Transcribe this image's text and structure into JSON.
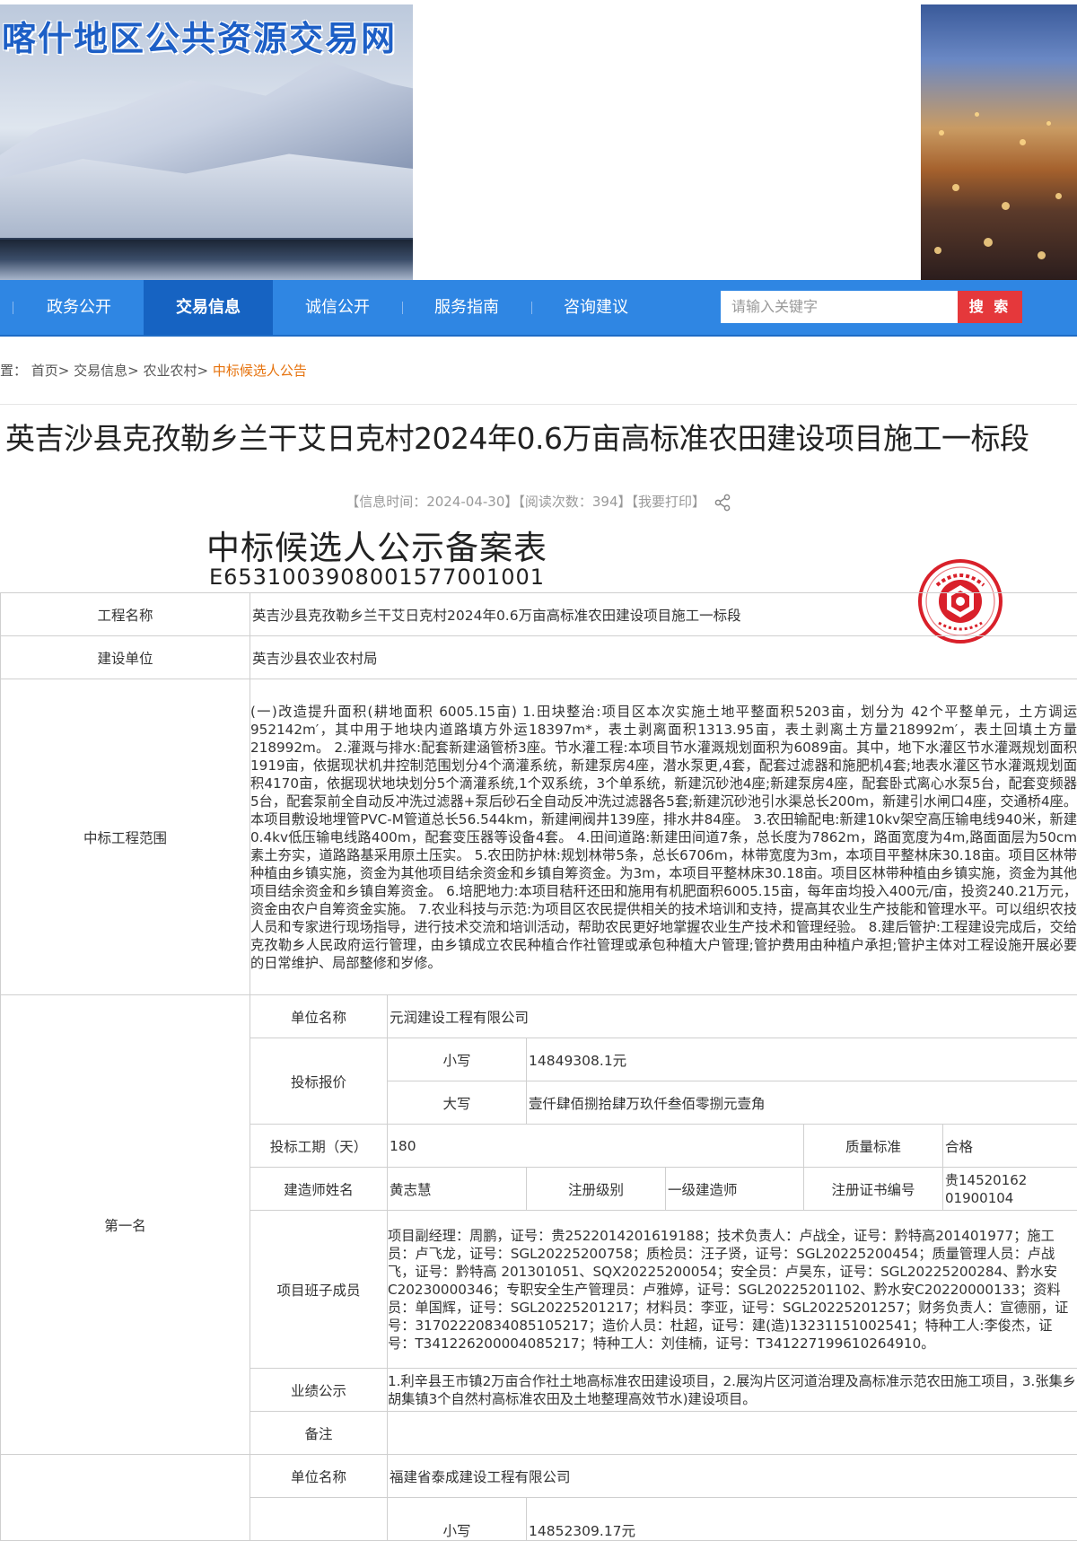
{
  "header": {
    "site_title": "喀什地区公共资源交易网"
  },
  "nav": {
    "items": [
      "政务公开",
      "交易信息",
      "诚信公开",
      "服务指南",
      "咨询建议"
    ],
    "active_index": 1,
    "search_placeholder": "请输入关键字",
    "search_button": "搜 索"
  },
  "breadcrumb": {
    "prefix": "置：",
    "items": [
      "首页>",
      "交易信息>",
      "农业农村>"
    ],
    "current": "中标候选人公告"
  },
  "article": {
    "title": "英吉沙县克孜勒乡兰干艾日克村2024年0.6万亩高标准农田建设项目施工一标段",
    "meta_time": "【信息时间：2024-04-30】",
    "meta_reads": "【阅读次数：394】",
    "meta_print": "【我要打印】",
    "doc_title": "中标候选人公示备案表",
    "doc_code": "E6531003908001577001001"
  },
  "table": {
    "project_name_label": "工程名称",
    "project_name": "英吉沙县克孜勒乡兰干艾日克村2024年0.6万亩高标准农田建设项目施工一标段",
    "builder_label": "建设单位",
    "builder": "英吉沙县农业农村局",
    "scope_label": "中标工程范围",
    "scope": "(一)改造提升面积(耕地面积 6005.15亩) 1.田块整治:项目区本次实施土地平整面积5203亩，划分为 42个平整单元，土方调运952142m′，其中用于地块内道路填方外运18397m*，表土剥离面积1313.95亩，表土剥离土方量218992m′，表土回填土方量218992m。 2.灌溉与排水:配套新建涵管桥3座。节水灌工程:本项目节水灌溉规划面积为6089亩。其中，地下水灌区节水灌溉规划面积1919亩，依据现状机井控制范围划分4个滴灌系统，新建泵房4座，潜水泵更,4套，配套过滤器和施肥机4套;地表水灌区节水灌溉规划面积4170亩，依据现状地块划分5个滴灌系统,1个双系统，3个单系统，新建沉砂池4座;新建泵房4座，配套卧式离心水泵5台，配套变频器5台，配套泵前全自动反冲洗过滤器+泵后砂石全自动反冲洗过滤器各5套;新建沉砂池引水渠总长200m，新建引水闸口4座，交通桥4座。本项目敷设地埋管PVC-M管道总长56.544km，新建闸阀井139座，排水井84座。 3.农田输配电:新建10kv架空高压输电线940米，新建0.4kv低压输电线路400m，配套变压器等设备4套。 4.田间道路:新建田间道7条，总长度为7862m，路面宽度为4m,路面面层为50cm素土夯实，道路路基采用原土压实。 5.农田防护林:规划林带5条，总长6706m，林带宽度为3m，本项目平整林床30.18亩。项目区林带种植由乡镇实施，资金为其他项目结余资金和乡镇自筹资金。为3m，本项目平整林床30.18亩。项目区林带种植由乡镇实施，资金为其他项目结余资金和乡镇自筹资金。 6.培肥地力:本项目秸秆还田和施用有机肥面积6005.15亩，每年亩均投入400元/亩，投资240.21万元，资金由农户自筹资金实施。 7.农业科技与示范:为项目区农民提供相关的技术培训和支持，提高其农业生产技能和管理水平。可以组织农技人员和专家进行现场指导，进行技术交流和培训活动，帮助农民更好地掌握农业生产技术和管理经验。 8.建后管护:工程建设完成后，交给克孜勒乡人民政府运行管理，由乡镇成立农民种植合作社管理或承包种植大户管理;管护费用由种植户承担;管护主体对工程设施开展必要的日常维护、局部整修和岁修。",
    "first": {
      "rank_label": "第一名",
      "unit_label": "单位名称",
      "unit": "元润建设工程有限公司",
      "bid_label": "投标报价",
      "lower_label": "小写",
      "lower": "14849308.1元",
      "upper_label": "大写",
      "upper": "壹仟肆佰捌拾肆万玖仟叁佰零捌元壹角",
      "period_label": "投标工期（天）",
      "period": "180",
      "quality_label": "质量标准",
      "quality": "合格",
      "builder_name_label": "建造师姓名",
      "builder_name": "黄志慧",
      "reg_level_label": "注册级别",
      "reg_level": "一级建造师",
      "cert_label": "注册证书编号",
      "cert": "贵14520162 01900104",
      "members_label": "项目班子成员",
      "members": "项目副经理：周鹏，证号：贵2522014201619188；技术负责人：卢战全，证号：黔特高201401977；施工员：卢飞龙，证号：SGL20225200758；质检员：汪子贤，证号：SGL20225200454；质量管理人员：卢战飞，证号：黔特高 201301051、SQX20225200054；安全员：卢昊东，证号：SGL20225200284、黔水安C20230000346；专职安全生产管理员：卢雅婷，证号：SGL20225201102、黔水安C20220000133；资料员：单国辉，证号：SGL20225201217；材料员：李亚，证号：SGL20225201257；财务负责人：宣德丽，证号：31702220834085105217；造价人员：杜超，证号：建(造)13231151002541；特种工人:李俊杰，证号：T341226200004085217；特种工人：刘佳楠，证号：T341227199610264910。",
      "performance_label": "业绩公示",
      "performance": "1.利辛县王市镇2万亩合作社土地高标准农田建设项目，2.展沟片区河道治理及高标准示范农田施工项目，3.张集乡胡集镇3个自然村高标准农田及土地整理高效节水)建设项目。",
      "remark_label": "备注"
    },
    "second": {
      "unit_label": "单位名称",
      "unit": "福建省泰成建设工程有限公司",
      "lower_label": "小写",
      "lower": "14852309.17元"
    }
  }
}
